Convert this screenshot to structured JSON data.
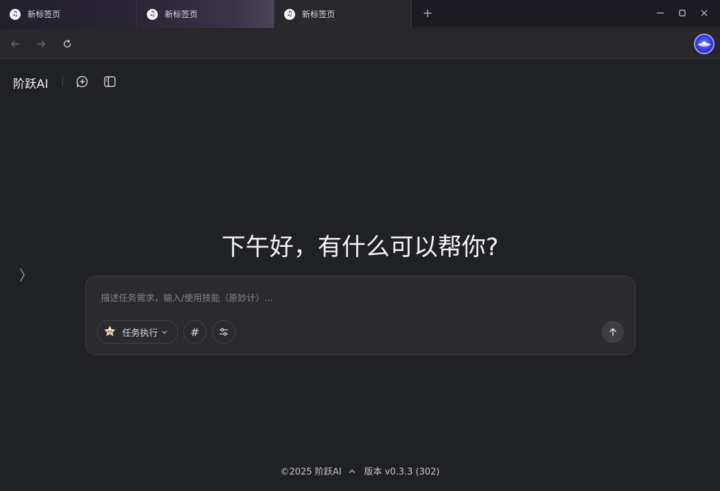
{
  "tabs": [
    {
      "label": "新标签页"
    },
    {
      "label": "新标签页"
    },
    {
      "label": "新标签页"
    }
  ],
  "tab_favicon_glyph": "♫",
  "new_tab_label": "+",
  "app": {
    "brand": "阶跃AI"
  },
  "greeting": "下午好，有什么可以帮你?",
  "composer": {
    "placeholder": "描述任务需求，输入/使用技能（原妙计）...",
    "mode_label": "任务执行",
    "hashtag_label": "#"
  },
  "footer": {
    "copyright": "©2025 阶跃AI",
    "version": "版本 v0.3.3 (302)"
  },
  "icons": {
    "back": "arrow-left-icon",
    "forward": "arrow-right-icon",
    "reload": "reload-icon",
    "new_chat": "new-chat-icon",
    "sidebar": "sidebar-panel-icon",
    "send": "arrow-up-icon",
    "settings": "sliders-icon"
  },
  "colors": {
    "background": "#202125",
    "composer": "#2b2b2f",
    "profile_accent": "#3134d8"
  }
}
